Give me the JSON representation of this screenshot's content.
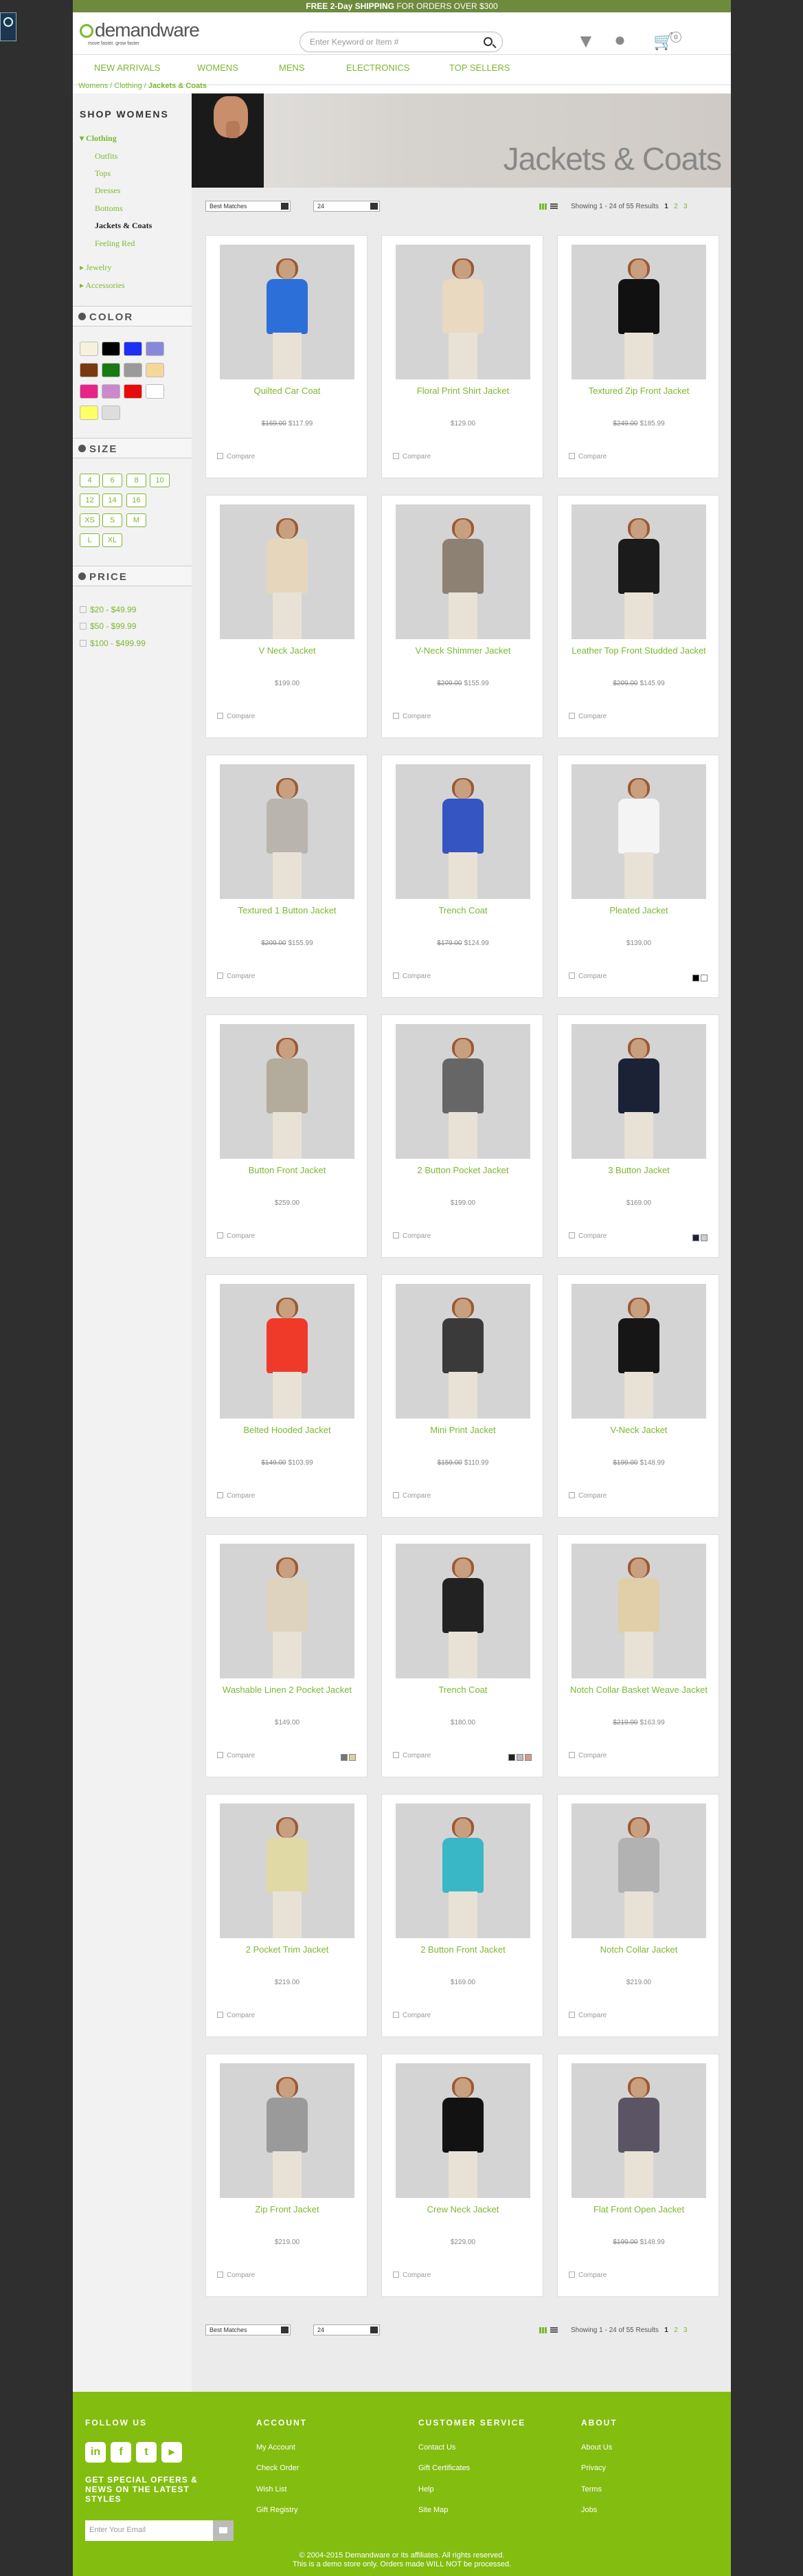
{
  "topbar": {
    "bold": "FREE 2-Day SHIPPING",
    "rest": " FOR ORDERS OVER $300"
  },
  "logo": {
    "name": "demandware",
    "tagline": "move faster. grow faster"
  },
  "search": {
    "placeholder": "Enter Keyword or Item #"
  },
  "nav": [
    "NEW ARRIVALS",
    "WOMENS",
    "MENS",
    "ELECTRONICS",
    "TOP SELLERS"
  ],
  "breadcrumb": {
    "a": "Womens",
    "b": "Clothing",
    "c": "Jackets & Coats"
  },
  "cart_count": "0",
  "sidebar": {
    "title": "SHOP WOMENS",
    "clothing": "Clothing",
    "sub": [
      "Outfits",
      "Tops",
      "Dresses",
      "Bottoms",
      "Jackets & Coats",
      "Feeling Red"
    ],
    "jewelry": "Jewelry",
    "accessories": "Accessories",
    "color_title": "COLOR",
    "colors": [
      "#f5f1dc",
      "#000000",
      "#1d2ef5",
      "#8888d8",
      "#7a3a10",
      "#197a14",
      "#9a9a9a",
      "#f4d89a",
      "#e8248a",
      "#cc88cc",
      "#e80b0b",
      "#ffffff",
      "#ffff66",
      "#dddddd"
    ],
    "size_title": "SIZE",
    "sizes": [
      "4",
      "6",
      "8",
      "10",
      "12",
      "14",
      "16",
      "XS",
      "S",
      "M",
      "L",
      "XL"
    ],
    "price_title": "PRICE",
    "prices": [
      "$20 - $49.99",
      "$50 - $99.99",
      "$100 - $499.99"
    ]
  },
  "banner_title": "Jackets & Coats",
  "sort": {
    "option": "Best Matches",
    "per_page": "24"
  },
  "results": {
    "text": "Showing 1 - 24 of 55 Results",
    "p1": "1",
    "p2": "2",
    "p3": "3"
  },
  "compare_label": "Compare",
  "products": [
    {
      "name": "Quilted Car Coat",
      "old": "$169.00",
      "price": "$117.99",
      "jacket": "#2d6fd8",
      "swatches": []
    },
    {
      "name": "Floral Print Shirt Jacket",
      "old": "",
      "price": "$129.00",
      "jacket": "#e9d9c0",
      "swatches": []
    },
    {
      "name": "Textured Zip Front Jacket",
      "old": "$249.00",
      "price": "$185.99",
      "jacket": "#111111",
      "swatches": []
    },
    {
      "name": "V Neck Jacket",
      "old": "",
      "price": "$199.00",
      "jacket": "#e6d7bc",
      "swatches": []
    },
    {
      "name": "V-Neck Shimmer Jacket",
      "old": "$209.00",
      "price": "$155.99",
      "jacket": "#8c8173",
      "swatches": []
    },
    {
      "name": "Leather Top Front Studded Jacket",
      "old": "$209.00",
      "price": "$145.99",
      "jacket": "#1b1b1b",
      "swatches": []
    },
    {
      "name": "Textured 1 Button Jacket",
      "old": "$209.00",
      "price": "$155.99",
      "jacket": "#b9b4ae",
      "swatches": []
    },
    {
      "name": "Trench Coat",
      "old": "$179.00",
      "price": "$124.99",
      "jacket": "#3455c2",
      "swatches": []
    },
    {
      "name": "Pleated Jacket",
      "old": "",
      "price": "$139.00",
      "jacket": "#f4f4f4",
      "swatches": [
        "#000000",
        "#ffffff"
      ]
    },
    {
      "name": "Button Front Jacket",
      "old": "",
      "price": "$259.00",
      "jacket": "#b3ab9b",
      "swatches": []
    },
    {
      "name": "2 Button Pocket Jacket",
      "old": "",
      "price": "$199.00",
      "jacket": "#666666",
      "swatches": []
    },
    {
      "name": "3 Button Jacket",
      "old": "",
      "price": "$169.00",
      "jacket": "#1c2236",
      "swatches": [
        "#1c2236",
        "#cccccc"
      ]
    },
    {
      "name": "Belted Hooded Jacket",
      "old": "$149.00",
      "price": "$103.99",
      "jacket": "#ef3a2a",
      "swatches": []
    },
    {
      "name": "Mini Print Jacket",
      "old": "$159.00",
      "price": "$110.99",
      "jacket": "#3a3a3a",
      "swatches": []
    },
    {
      "name": "V-Neck Jacket",
      "old": "$199.00",
      "price": "$148.99",
      "jacket": "#161616",
      "swatches": []
    },
    {
      "name": "Washable Linen 2 Pocket Jacket",
      "old": "",
      "price": "$149.00",
      "jacket": "#ddd3be",
      "swatches": [
        "#777777",
        "#d8d0a0"
      ]
    },
    {
      "name": "Trench Coat",
      "old": "",
      "price": "$180.00",
      "jacket": "#222222",
      "swatches": [
        "#222222",
        "#bbbbbb",
        "#d49a8a"
      ]
    },
    {
      "name": "Notch Collar Basket Weave Jacket",
      "old": "$219.00",
      "price": "$163.99",
      "jacket": "#e0cfa8",
      "swatches": []
    },
    {
      "name": "2 Pocket Trim Jacket",
      "old": "",
      "price": "$219.00",
      "jacket": "#e0d9a6",
      "swatches": []
    },
    {
      "name": "2 Button Front Jacket",
      "old": "",
      "price": "$169.00",
      "jacket": "#3ab7c6",
      "swatches": []
    },
    {
      "name": "Notch Collar Jacket",
      "old": "",
      "price": "$219.00",
      "jacket": "#b2b2b2",
      "swatches": []
    },
    {
      "name": "Zip Front Jacket",
      "old": "",
      "price": "$219.00",
      "jacket": "#9a9a9a",
      "swatches": []
    },
    {
      "name": "Crew Neck Jacket",
      "old": "",
      "price": "$229.00",
      "jacket": "#121212",
      "swatches": []
    },
    {
      "name": "Flat Front Open Jacket",
      "old": "$199.00",
      "price": "$148.99",
      "jacket": "#5b5464",
      "swatches": []
    }
  ],
  "footer": {
    "follow": "FOLLOW US",
    "special": "GET SPECIAL OFFERS & NEWS ON THE LATEST STYLES",
    "email_placeholder": "Enter Your Email",
    "account_title": "ACCOUNT",
    "account": [
      "My Account",
      "Check Order",
      "Wish List",
      "Gift Registry"
    ],
    "service_title": "CUSTOMER SERVICE",
    "service": [
      "Contact Us",
      "Gift Certificates",
      "Help",
      "Site Map"
    ],
    "about_title": "ABOUT",
    "about": [
      "About Us",
      "Privacy",
      "Terms",
      "Jobs"
    ],
    "copyright": "© 2004-2015 Demandware or its affiliates. All rights reserved.",
    "demo": "This is a demo store only. Orders made WILL NOT be processed."
  }
}
